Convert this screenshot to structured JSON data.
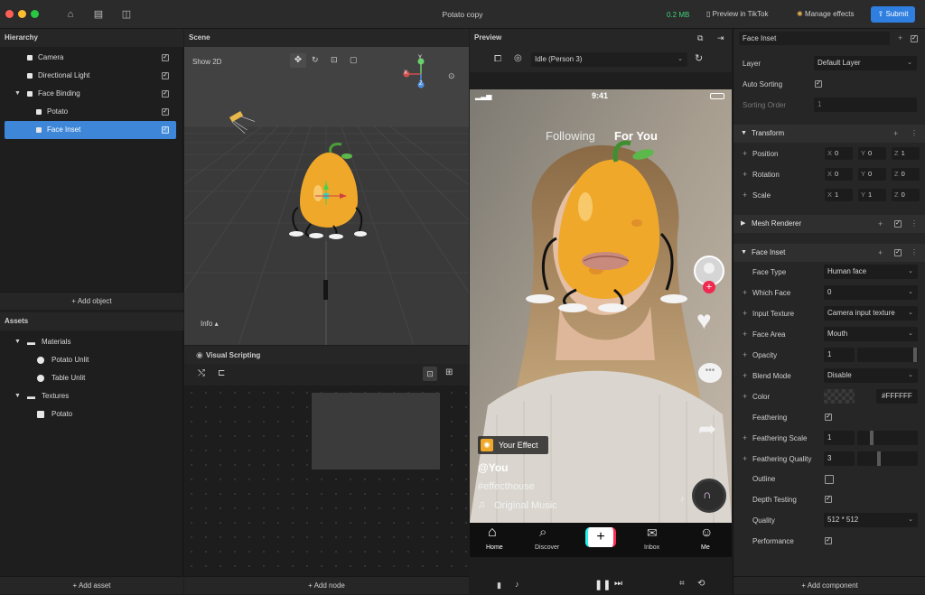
{
  "window": {
    "title": "Potato copy",
    "size": "0.2 MB",
    "preview_tiktok": "Preview in TikTok",
    "manage_effects": "Manage effects",
    "submit": "Submit"
  },
  "hierarchy": {
    "title": "Hierarchy",
    "items": [
      {
        "label": "Camera"
      },
      {
        "label": "Directional Light"
      },
      {
        "label": "Face Binding"
      },
      {
        "label": "Potato"
      },
      {
        "label": "Face Inset"
      }
    ],
    "add_object": "+ Add object"
  },
  "assets": {
    "title": "Assets",
    "items": [
      {
        "label": "Materials"
      },
      {
        "label": "Potato Unlit"
      },
      {
        "label": "Table Unlit"
      },
      {
        "label": "Textures"
      },
      {
        "label": "Potato"
      }
    ],
    "add_asset": "+ Add asset"
  },
  "scene": {
    "title": "Scene",
    "show2d": "Show 2D",
    "info": "Info",
    "axis_y": "Y",
    "axis_x": "X",
    "axis_z": "Z"
  },
  "visual_scripting": {
    "title": "Visual Scripting",
    "add_node": "+ Add node"
  },
  "preview": {
    "title": "Preview",
    "state_select": "Idle (Person 3)",
    "status_time": "9:41",
    "tab_following": "Following",
    "tab_for_you": "For You",
    "effect_badge": "Your Effect",
    "username": "@You",
    "hashtag": "#effecthouse",
    "music": "Original Music",
    "nav": [
      {
        "label": "Home"
      },
      {
        "label": "Discover"
      },
      {
        "label": "Inbox"
      },
      {
        "label": "Me"
      }
    ]
  },
  "inspector": {
    "object_name": "Face Inset",
    "layer_label": "Layer",
    "layer_value": "Default Layer",
    "auto_sorting": "Auto Sorting",
    "sorting_order": "Sorting Order",
    "sorting_order_value": "1",
    "transform": {
      "title": "Transform",
      "position": {
        "label": "Position",
        "x": "0",
        "y": "0",
        "z": "1"
      },
      "rotation": {
        "label": "Rotation",
        "x": "0",
        "y": "0",
        "z": "0"
      },
      "scale": {
        "label": "Scale",
        "x": "1",
        "y": "1",
        "z": "0"
      }
    },
    "mesh_renderer": "Mesh Renderer",
    "face_inset": {
      "title": "Face Inset",
      "face_type_label": "Face Type",
      "face_type": "Human face",
      "which_face_label": "Which Face",
      "which_face": "0",
      "input_texture_label": "Input Texture",
      "input_texture": "Camera input texture",
      "face_area_label": "Face Area",
      "face_area": "Mouth",
      "opacity_label": "Opacity",
      "opacity": "1",
      "blend_mode_label": "Blend Mode",
      "blend_mode": "Disable",
      "color_label": "Color",
      "color": "#FFFFFF",
      "feathering_label": "Feathering",
      "feathering_scale_label": "Feathering Scale",
      "feathering_scale": "1",
      "feathering_quality_label": "Feathering Quality",
      "feathering_quality": "3",
      "outline_label": "Outline",
      "depth_testing_label": "Depth Testing",
      "quality_label": "Quality",
      "quality": "512 * 512",
      "performance_label": "Performance"
    },
    "add_component": "+ Add component"
  },
  "colors": {
    "accent": "#2f7fe0",
    "selection": "#3d86d8",
    "size_green": "#3fd17a",
    "potato": "#f0a82a"
  }
}
